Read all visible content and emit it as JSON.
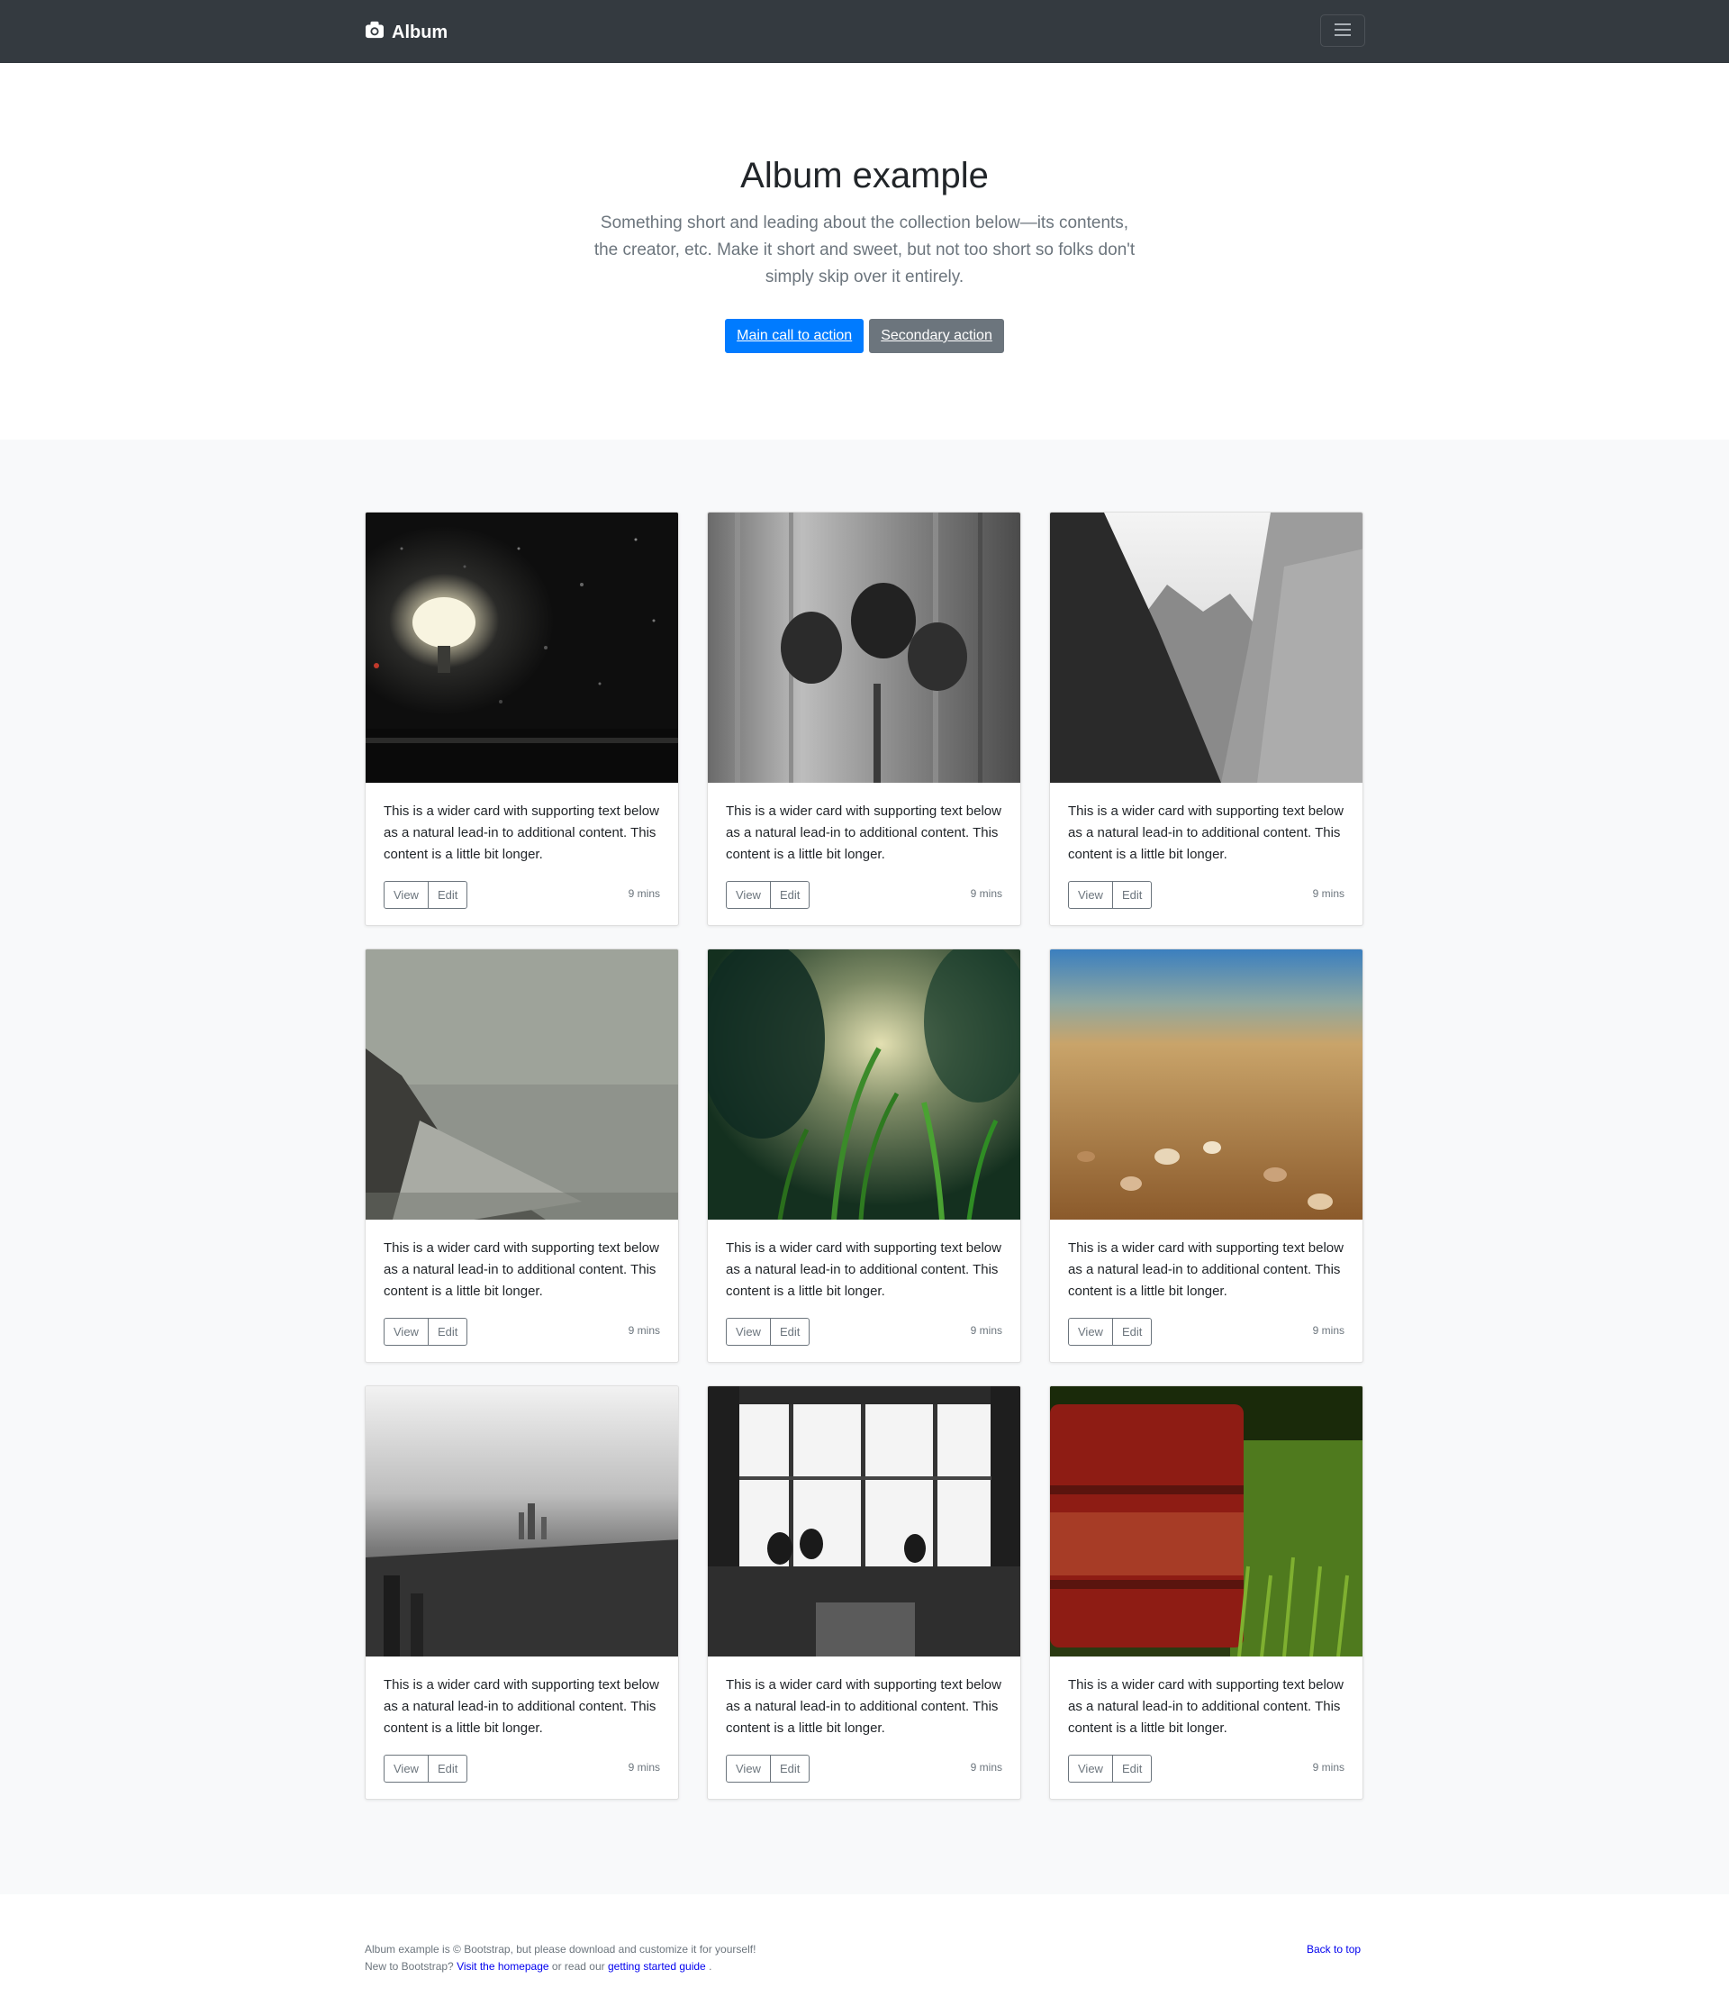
{
  "navbar": {
    "brand_label": "Album",
    "brand_icon": "camera-icon",
    "menu_icon": "hamburger-menu-icon"
  },
  "hero": {
    "title": "Album example",
    "lead": "Something short and leading about the collection below—its contents, the creator, etc. Make it short and sweet, but not too short so folks don't simply skip over it entirely.",
    "primary_label": "Main call to action",
    "secondary_label": "Secondary action"
  },
  "cards": [
    {
      "image": "night-street-lamp-photo",
      "text": "This is a wider card with supporting text below as a natural lead-in to additional content. This content is a little bit longer.",
      "view_label": "View",
      "edit_label": "Edit",
      "time": "9 mins"
    },
    {
      "image": "pinecones-photo",
      "text": "This is a wider card with supporting text below as a natural lead-in to additional content. This content is a little bit longer.",
      "view_label": "View",
      "edit_label": "Edit",
      "time": "9 mins"
    },
    {
      "image": "mountain-valley-photo",
      "text": "This is a wider card with supporting text below as a natural lead-in to additional content. This content is a little bit longer.",
      "view_label": "View",
      "edit_label": "Edit",
      "time": "9 mins"
    },
    {
      "image": "foggy-beach-photo",
      "text": "This is a wider card with supporting text below as a natural lead-in to additional content. This content is a little bit longer.",
      "view_label": "View",
      "edit_label": "Edit",
      "time": "9 mins"
    },
    {
      "image": "grass-closeup-photo",
      "text": "This is a wider card with supporting text below as a natural lead-in to additional content. This content is a little bit longer.",
      "view_label": "View",
      "edit_label": "Edit",
      "time": "9 mins"
    },
    {
      "image": "seashells-beach-photo",
      "text": "This is a wider card with supporting text below as a natural lead-in to additional content. This content is a little bit longer.",
      "view_label": "View",
      "edit_label": "Edit",
      "time": "9 mins"
    },
    {
      "image": "city-skyline-photo",
      "text": "This is a wider card with supporting text below as a natural lead-in to additional content. This content is a little bit longer.",
      "view_label": "View",
      "edit_label": "Edit",
      "time": "9 mins"
    },
    {
      "image": "cafe-silhouettes-photo",
      "text": "This is a wider card with supporting text below as a natural lead-in to additional content. This content is a little bit longer.",
      "view_label": "View",
      "edit_label": "Edit",
      "time": "9 mins"
    },
    {
      "image": "red-barrel-photo",
      "text": "This is a wider card with supporting text below as a natural lead-in to additional content. This content is a little bit longer.",
      "view_label": "View",
      "edit_label": "Edit",
      "time": "9 mins"
    }
  ],
  "footer": {
    "line1": "Album example is © Bootstrap, but please download and customize it for yourself!",
    "line2_prefix": "New to Bootstrap?",
    "homepage_link": "Visit the homepage",
    "line2_middle": "or read our",
    "guide_link": "getting started guide",
    "line2_suffix": ".",
    "back_to_top": "Back to top"
  },
  "colors": {
    "navbar_bg": "#343a40",
    "primary": "#007bff",
    "secondary": "#6c757d",
    "album_bg": "#f8f9fa",
    "link": "#0000ee"
  }
}
